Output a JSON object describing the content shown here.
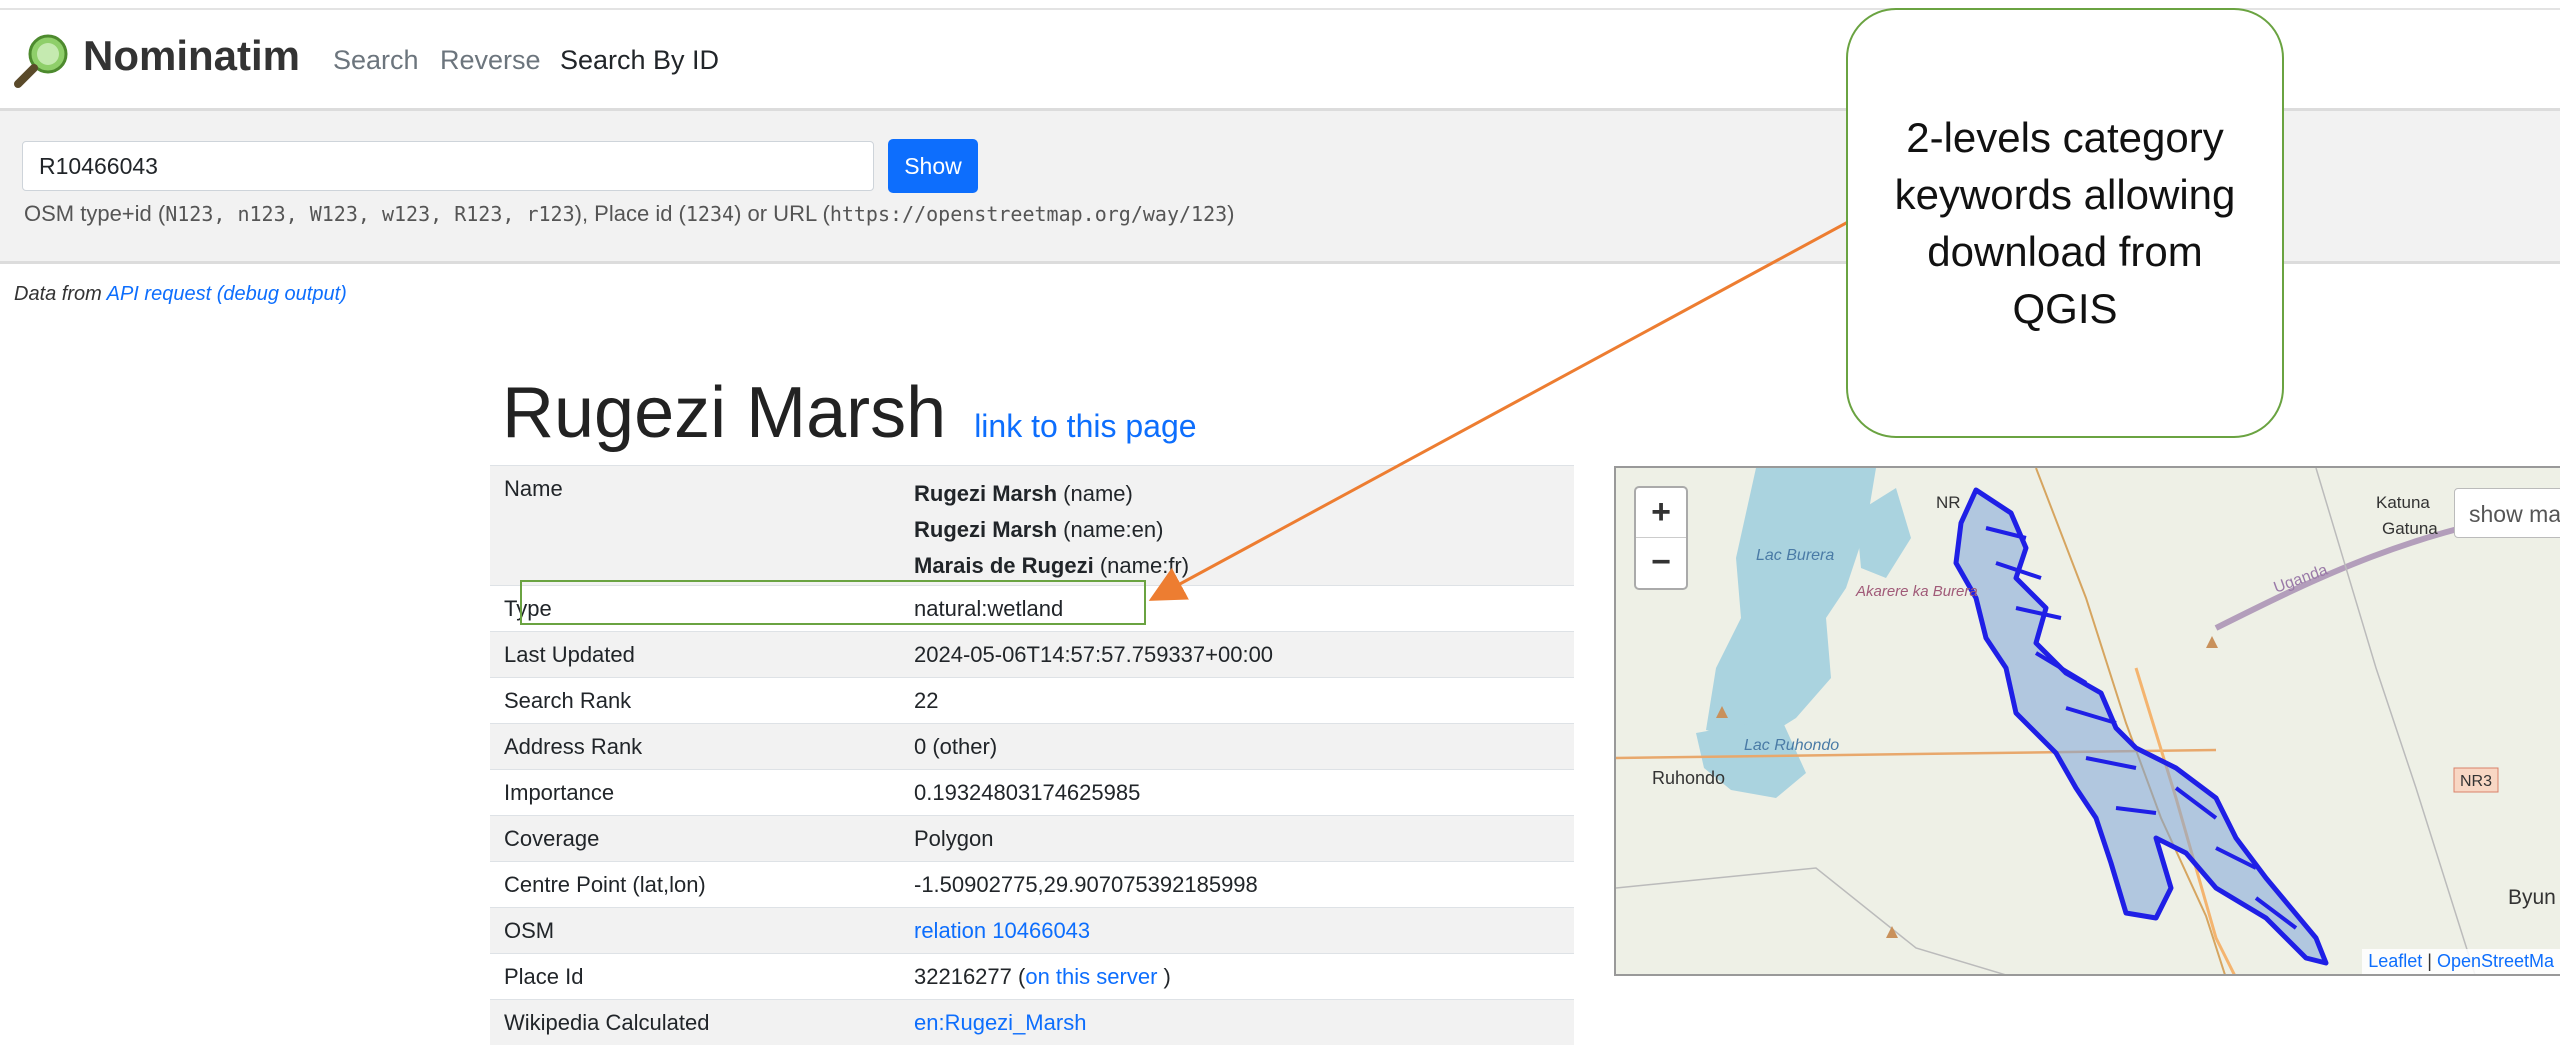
{
  "brand": "Nominatim",
  "nav": [
    "Search",
    "Reverse",
    "Search By ID"
  ],
  "search": {
    "value": "R10466043",
    "button": "Show",
    "help_prefix": "OSM type+id (",
    "help_ids": "N123, n123, W123, w123, R123, r123",
    "help_mid": "), Place id (",
    "help_place": "1234",
    "help_mid2": ") or URL (",
    "help_url": "https://openstreetmap.org/way/123",
    "help_suffix": ")"
  },
  "datafrom": {
    "prefix": "Data from ",
    "api": "API request",
    "debug": "(debug output)"
  },
  "title": "Rugezi Marsh",
  "title_link": "link to this page",
  "details": [
    {
      "key": "Name",
      "names": [
        {
          "value": "Rugezi Marsh",
          "tag": "(name)"
        },
        {
          "value": "Rugezi Marsh",
          "tag": "(name:en)"
        },
        {
          "value": "Marais de Rugezi",
          "tag": "(name:fr)"
        }
      ]
    },
    {
      "key": "Type",
      "value": "natural:wetland"
    },
    {
      "key": "Last Updated",
      "value": "2024-05-06T14:57:57.759337+00:00"
    },
    {
      "key": "Search Rank",
      "value": "22"
    },
    {
      "key": "Address Rank",
      "value": "0 (other)"
    },
    {
      "key": "Importance",
      "value": "0.19324803174625985"
    },
    {
      "key": "Coverage",
      "value": "Polygon"
    },
    {
      "key": "Centre Point (lat,lon)",
      "value": "-1.50902775,29.907075392185998"
    },
    {
      "key": "OSM",
      "link": "relation 10466043"
    },
    {
      "key": "Place Id",
      "value": "32216277",
      "paren_open": " (",
      "link": "on this server",
      "paren_close": " )"
    },
    {
      "key": "Wikipedia Calculated",
      "link": "en:Rugezi_Marsh"
    }
  ],
  "map": {
    "zoom_in": "+",
    "zoom_out": "−",
    "show_map": "show ma",
    "labels": [
      "NR",
      "Lac Burera",
      "Akarere ka Burera",
      "Uganda",
      "Katuna",
      "Gatuna",
      "Lac Ruhondo",
      "Ruhondo",
      "NR3",
      "Byun"
    ],
    "attribution": {
      "leaflet": "Leaflet",
      "sep": " | ",
      "osm": "OpenStreetMa"
    }
  },
  "callout": "2-levels category keywords allowing download from QGIS",
  "colors": {
    "accent": "#0d6efd",
    "callout_border": "#6aa341",
    "arrow": "#ed7d31",
    "polygon": "#1f1fe6"
  }
}
